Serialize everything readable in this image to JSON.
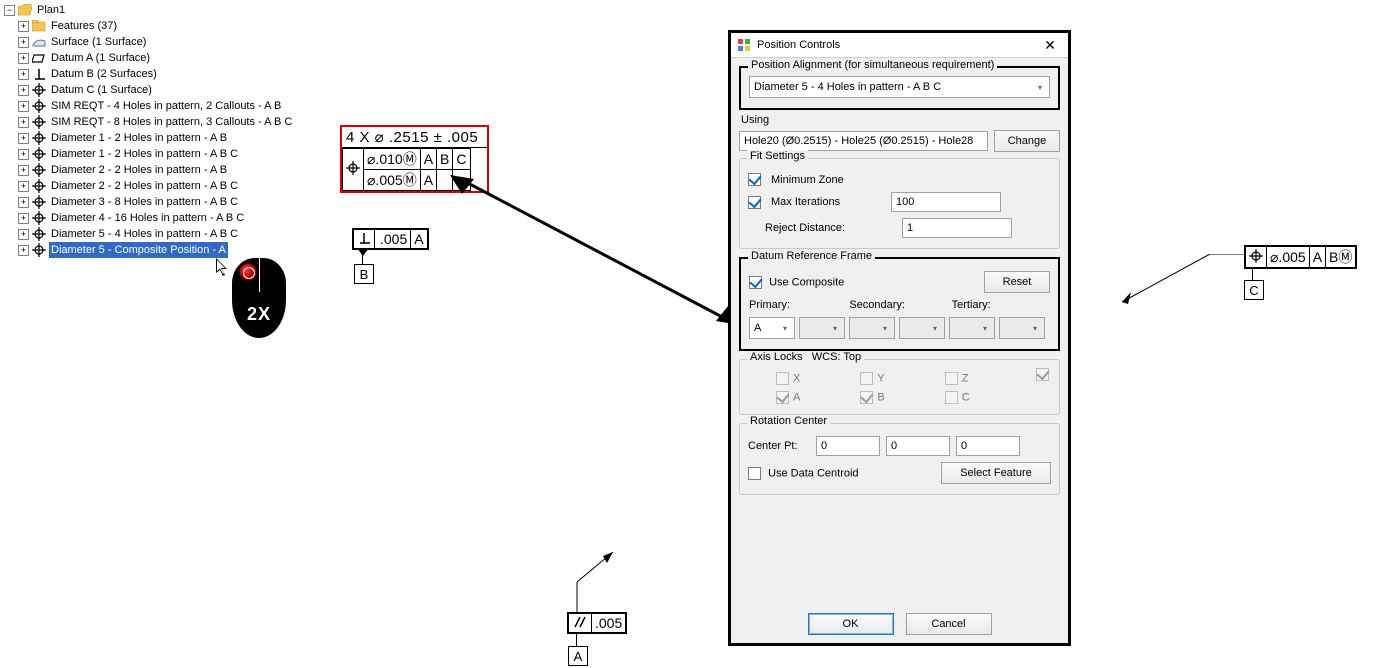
{
  "tree": {
    "root": "Plan1",
    "features_label": "Features (37)",
    "items": [
      {
        "label": "Surface (1 Surface)",
        "icon": "surface"
      },
      {
        "label": "Datum A (1 Surface)",
        "icon": "datum"
      },
      {
        "label": "Datum B (2 Surfaces)",
        "icon": "perp"
      },
      {
        "label": "Datum C (1 Surface)",
        "icon": "pos"
      },
      {
        "label": "SIM REQT - 4 Holes in pattern, 2 Callouts - A B",
        "icon": "pos"
      },
      {
        "label": "SIM REQT - 8 Holes in pattern, 3 Callouts - A B C",
        "icon": "pos"
      },
      {
        "label": "Diameter 1 - 2 Holes in pattern - A B",
        "icon": "pos"
      },
      {
        "label": "Diameter 1 - 2 Holes in pattern - A B C",
        "icon": "pos"
      },
      {
        "label": "Diameter 2 - 2 Holes in pattern - A B",
        "icon": "pos"
      },
      {
        "label": "Diameter 2 - 2 Holes in pattern - A B C",
        "icon": "pos"
      },
      {
        "label": "Diameter 3 - 8 Holes in pattern - A B C",
        "icon": "pos"
      },
      {
        "label": "Diameter 4 - 16 Holes in pattern - A B C",
        "icon": "pos"
      },
      {
        "label": "Diameter 5 - 4 Holes in pattern - A B C",
        "icon": "pos"
      },
      {
        "label": "Diameter 5 - Composite Position - A",
        "icon": "pos",
        "selected": true
      }
    ]
  },
  "mouse_hint": "2X",
  "fcf_main": {
    "hdr": "4 X ⌀ .2515 ± .005",
    "r1_tol": "⌀.010",
    "r1_mod": "Ⓜ",
    "r1_d1": "A",
    "r1_d2": "B",
    "r1_d3": "C",
    "r2_tol": "⌀.005",
    "r2_mod": "Ⓜ",
    "r2_d1": "A"
  },
  "fcf_perp": {
    "tol": ".005",
    "d1": "A",
    "flag": "B"
  },
  "fcf_paral": {
    "tol": ".005",
    "flag": "A"
  },
  "fcf_right": {
    "tol": "⌀.005",
    "d1": "A",
    "d2": "B",
    "mod": "Ⓜ",
    "flag": "C"
  },
  "dlg": {
    "title": "Position Controls",
    "pos_align_label": "Position Alignment (for simultaneous requirement)",
    "pos_align_value": "Diameter 5 - 4 Holes in pattern - A B C",
    "using_label": "Using",
    "using_value": "Hole20 (Ø0.2515) - Hole25 (Ø0.2515) - Hole28",
    "change_btn": "Change",
    "fit_label": "Fit Settings",
    "min_zone": "Minimum Zone",
    "max_iter": "Max Iterations",
    "max_iter_val": "100",
    "reject": "Reject Distance:",
    "reject_val": "1",
    "drf_label": "Datum Reference Frame",
    "use_comp": "Use Composite",
    "reset": "Reset",
    "primary": "Primary:",
    "secondary": "Secondary:",
    "tertiary": "Tertiary:",
    "primary_val": "A",
    "axis_locks": "Axis Locks",
    "wcs": "WCS:  Top",
    "ax_x": "X",
    "ax_y": "Y",
    "ax_z": "Z",
    "ax_a": "A",
    "ax_b": "B",
    "ax_c": "C",
    "rot_label": "Rotation Center",
    "center_pt": "Center Pt:",
    "c0": "0",
    "c1": "0",
    "c2": "0",
    "use_centroid": "Use Data Centroid",
    "select_feat": "Select Feature",
    "ok": "OK",
    "cancel": "Cancel"
  }
}
